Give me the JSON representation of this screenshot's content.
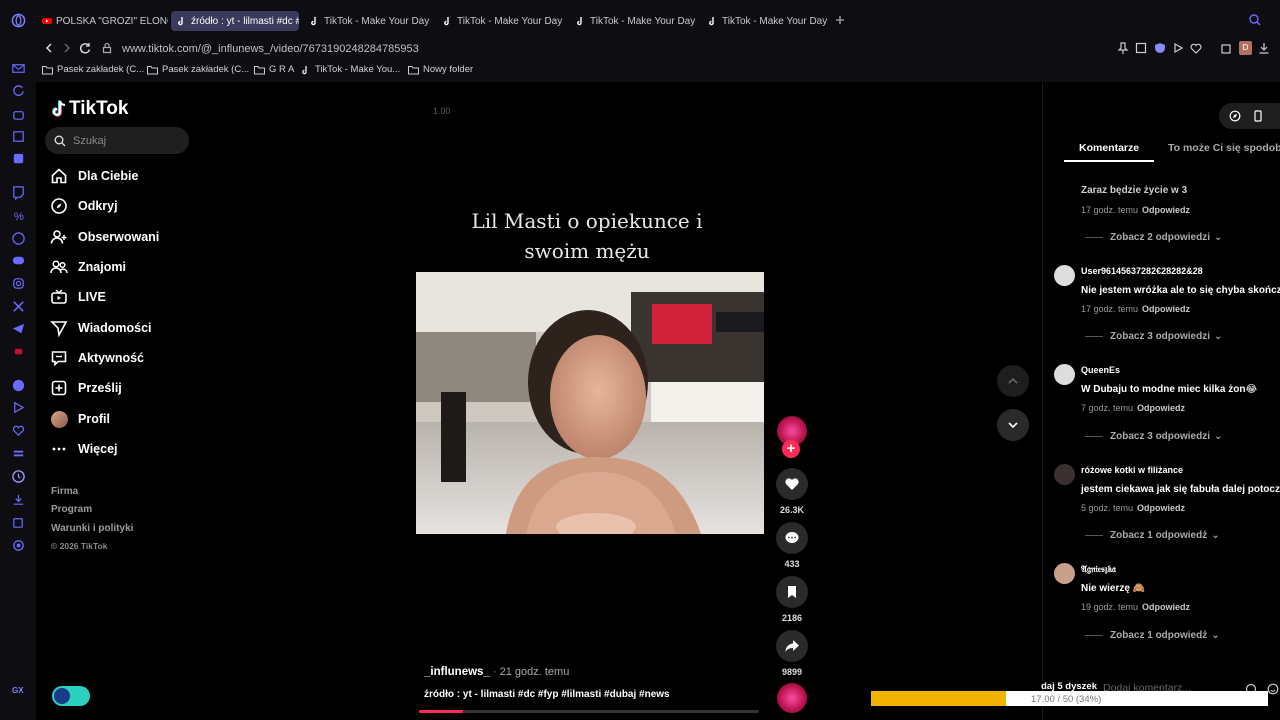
{
  "browser": {
    "tabs": [
      {
        "label": "POLSKA \"GROZI\" ELONOW",
        "favicon": "youtube-icon"
      },
      {
        "label": "źródło : yt - lilmasti #dc #f",
        "favicon": "tiktok-icon",
        "active": true
      },
      {
        "label": "TikTok - Make Your Day",
        "favicon": "tiktok-icon"
      },
      {
        "label": "TikTok - Make Your Day",
        "favicon": "tiktok-icon"
      },
      {
        "label": "TikTok - Make Your Day",
        "favicon": "tiktok-icon"
      },
      {
        "label": "TikTok - Make Your Day",
        "favicon": "tiktok-icon"
      }
    ],
    "url": "www.tiktok.com/@_influnews_/video/7673190248284785953",
    "bookmarks": [
      {
        "label": "Pasek zakładek (C..."
      },
      {
        "label": "Pasek zakładek (C..."
      },
      {
        "label": "G R A"
      },
      {
        "label": "TikTok - Make You..."
      },
      {
        "label": "Nowy folder"
      }
    ],
    "profile_initial": "D",
    "sidebar_label": "GX"
  },
  "tiktok": {
    "logo_text": "TikTok",
    "search_placeholder": "Szukaj",
    "nav": [
      {
        "label": "Dla Ciebie",
        "icon": "home-icon"
      },
      {
        "label": "Odkryj",
        "icon": "compass-icon"
      },
      {
        "label": "Obserwowani",
        "icon": "user-plus-icon"
      },
      {
        "label": "Znajomi",
        "icon": "friends-icon"
      },
      {
        "label": "LIVE",
        "icon": "live-icon"
      },
      {
        "label": "Wiadomości",
        "icon": "send-icon"
      },
      {
        "label": "Aktywność",
        "icon": "message-icon"
      },
      {
        "label": "Prześlij",
        "icon": "upload-icon"
      },
      {
        "label": "Profil",
        "icon": "avatar"
      },
      {
        "label": "Więcej",
        "icon": "more-icon"
      }
    ],
    "footer": [
      "Firma",
      "Program",
      "Warunki i polityki"
    ],
    "copyright": "© 2026 TikTok",
    "video": {
      "speed": "1.00",
      "caption_line1": "Lil Masti o opiekunce i",
      "caption_line2": "swoim mężu",
      "author": "_influnews_",
      "time_ago": "21 godz. temu",
      "description": "źródło : yt - lilmasti #dc #fyp #lilmasti #dubaj #news",
      "progress": 0.13
    },
    "actions": {
      "likes": "26.3K",
      "comments": "433",
      "saves": "2186",
      "shares": "9899"
    },
    "panel": {
      "tab_comments": "Komentarze",
      "tab_suggested": "To może Ci się spodobać",
      "reply_label": "Odpowiedz",
      "comments": [
        {
          "user": "",
          "text": "Zaraz będzie życie w 3",
          "time": "17 godz. temu",
          "more": "Zobacz 2 odpowiedzi"
        },
        {
          "user": "User9614563728­2€28282&28",
          "text": "Nie jestem wróżka ale to się chyba skończy",
          "time": "17 godz. temu",
          "more": "Zobacz 3 odpowiedzi"
        },
        {
          "user": "QueenEs",
          "text": "W Dubaju to modne miec kilka żon😂",
          "time": "7 godz. temu",
          "more": "Zobacz 3 odpowiedzi"
        },
        {
          "user": "różowe kotki w filiżance",
          "text": "jestem ciekawa jak się fabuła dalej potoczy",
          "time": "5 godz. temu",
          "more": "Zobacz 1 odpowiedź"
        },
        {
          "user": "𝔄𝔤𝔫𝔦𝔢𝔰𝔷𝔨𝔞",
          "text": "Nie wierzę 🙈",
          "time": "19 godz. temu",
          "more": "Zobacz 1 odpowiedź"
        }
      ],
      "add_comment_placeholder": "Dodaj komentarz..."
    }
  },
  "overlay": {
    "goal_title": "daj 5 dyszek",
    "goal_status": "17.00 / 50 (34%)",
    "goal_fraction": 0.34
  }
}
